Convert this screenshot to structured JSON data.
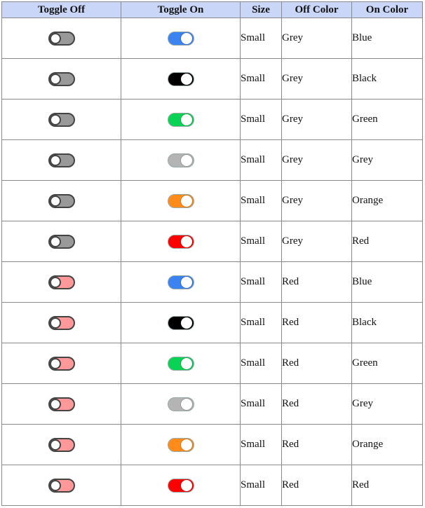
{
  "headers": {
    "toggle_off": "Toggle Off",
    "toggle_on": "Toggle On",
    "size": "Size",
    "off_color": "Off Color",
    "on_color": "On Color"
  },
  "colors": {
    "Grey": "#999999",
    "Red": "#ff9999",
    "Blue": "#3b83f0",
    "Black": "#000000",
    "Green": "#0ad255",
    "GreyOn": "#b4b4b4",
    "Orange": "#ff8c1a",
    "RedOn": "#ff0000"
  },
  "rows": [
    {
      "size": "Small",
      "off_color": "Grey",
      "on_color": "Blue",
      "off_hex": "#999999",
      "on_hex": "#3b83f0"
    },
    {
      "size": "Small",
      "off_color": "Grey",
      "on_color": "Black",
      "off_hex": "#999999",
      "on_hex": "#000000"
    },
    {
      "size": "Small",
      "off_color": "Grey",
      "on_color": "Green",
      "off_hex": "#999999",
      "on_hex": "#0ad255"
    },
    {
      "size": "Small",
      "off_color": "Grey",
      "on_color": "Grey",
      "off_hex": "#999999",
      "on_hex": "#b4b4b4"
    },
    {
      "size": "Small",
      "off_color": "Grey",
      "on_color": "Orange",
      "off_hex": "#999999",
      "on_hex": "#ff8c1a"
    },
    {
      "size": "Small",
      "off_color": "Grey",
      "on_color": "Red",
      "off_hex": "#999999",
      "on_hex": "#ff0000"
    },
    {
      "size": "Small",
      "off_color": "Red",
      "on_color": "Blue",
      "off_hex": "#ff9999",
      "on_hex": "#3b83f0"
    },
    {
      "size": "Small",
      "off_color": "Red",
      "on_color": "Black",
      "off_hex": "#ff9999",
      "on_hex": "#000000"
    },
    {
      "size": "Small",
      "off_color": "Red",
      "on_color": "Green",
      "off_hex": "#ff9999",
      "on_hex": "#0ad255"
    },
    {
      "size": "Small",
      "off_color": "Red",
      "on_color": "Grey",
      "off_hex": "#ff9999",
      "on_hex": "#b4b4b4"
    },
    {
      "size": "Small",
      "off_color": "Red",
      "on_color": "Orange",
      "off_hex": "#ff9999",
      "on_hex": "#ff8c1a"
    },
    {
      "size": "Small",
      "off_color": "Red",
      "on_color": "Red",
      "off_hex": "#ff9999",
      "on_hex": "#ff0000"
    }
  ]
}
